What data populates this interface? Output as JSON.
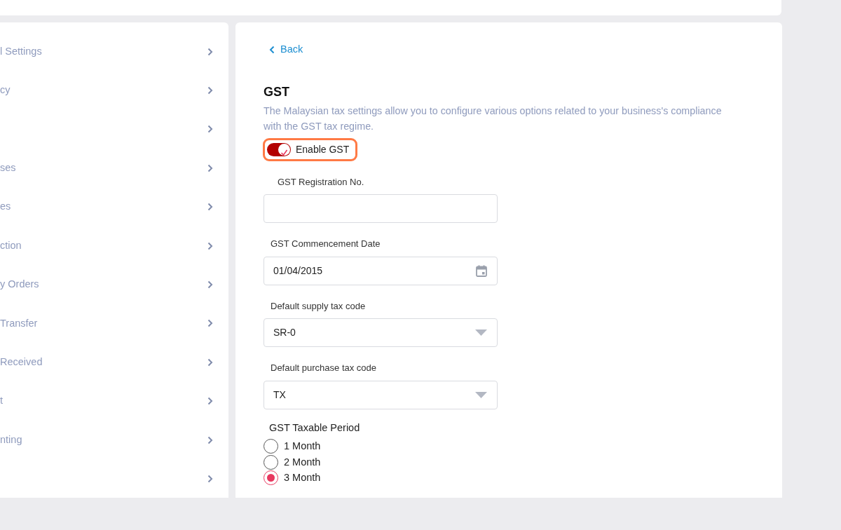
{
  "sidebar": {
    "items": [
      {
        "kind": "labeled",
        "label": "l Settings"
      },
      {
        "kind": "labeled",
        "label": "cy"
      },
      {
        "kind": "blank"
      },
      {
        "kind": "labeled",
        "label": "ses"
      },
      {
        "kind": "labeled",
        "label": "es"
      },
      {
        "kind": "labeled",
        "label": "ction"
      },
      {
        "kind": "labeled",
        "label": "y Orders"
      },
      {
        "kind": "labeled",
        "label": "Transfer"
      },
      {
        "kind": "labeled",
        "label": "Received"
      },
      {
        "kind": "labeled",
        "label": "t"
      },
      {
        "kind": "labeled",
        "label": "nting"
      },
      {
        "kind": "blank"
      }
    ]
  },
  "back_link": "Back",
  "section": {
    "title": "GST",
    "description": "The Malaysian tax settings allow you to configure various options related to your business's compliance with the GST tax regime."
  },
  "enable_toggle": {
    "label": "Enable GST",
    "on": true
  },
  "fields": [
    {
      "kind": "text",
      "label": "GST Registration No."
    },
    {
      "kind": "date",
      "label": "GST Commencement Date",
      "value": "01/04/2015"
    },
    {
      "kind": "select",
      "label": "Default supply tax code",
      "value": "SR-0"
    },
    {
      "kind": "select",
      "label": "Default purchase tax code",
      "value": "TX"
    }
  ],
  "taxable_period": {
    "label": "GST Taxable Period",
    "options": [
      {
        "label": "1 Month",
        "selected": false
      },
      {
        "label": "2 Month",
        "selected": false
      },
      {
        "label": "3 Month",
        "selected": true
      }
    ]
  }
}
